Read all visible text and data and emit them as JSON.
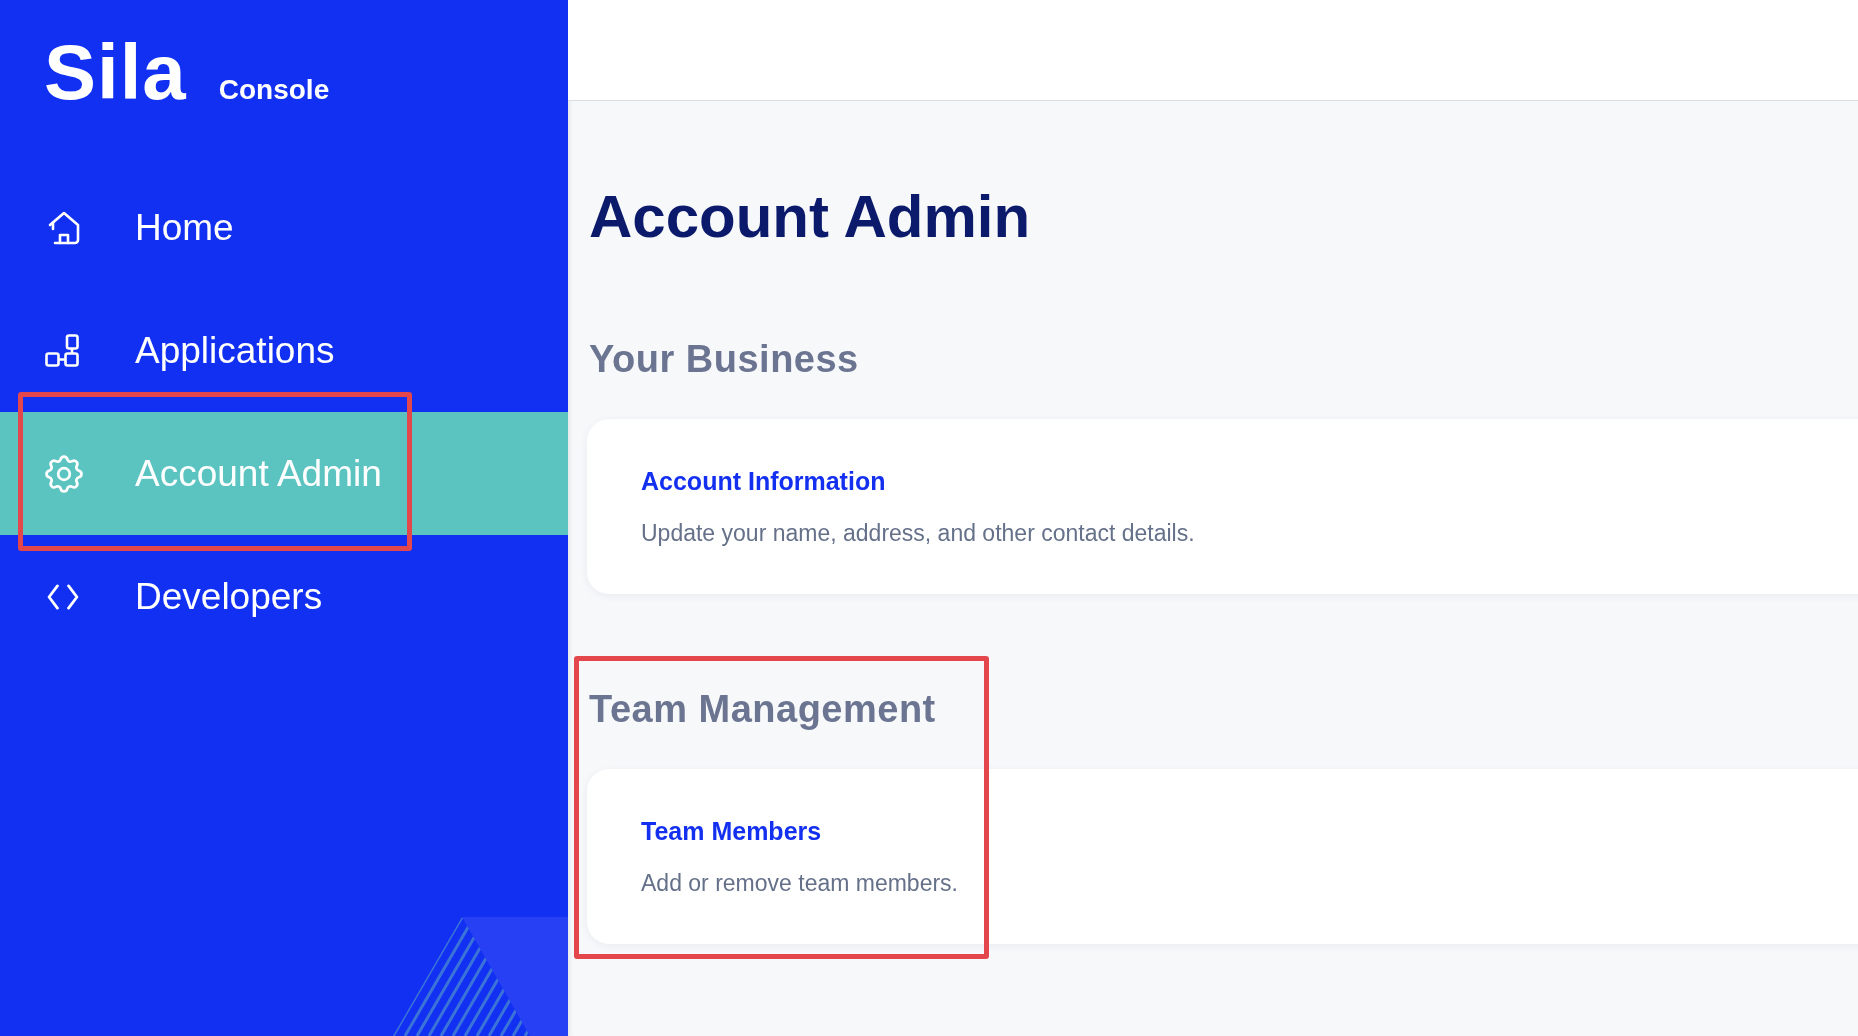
{
  "sidebar": {
    "logo": {
      "wordmark": "Sila",
      "product": "Console"
    },
    "items": [
      {
        "label": "Home",
        "selected": false,
        "highlighted": false
      },
      {
        "label": "Applications",
        "selected": false,
        "highlighted": false
      },
      {
        "label": "Account Admin",
        "selected": true,
        "highlighted": true
      },
      {
        "label": "Developers",
        "selected": false,
        "highlighted": false
      }
    ]
  },
  "page": {
    "title": "Account Admin",
    "sections": [
      {
        "heading": "Your Business",
        "highlighted": false,
        "cards": [
          {
            "title": "Account Information",
            "description": "Update your name, address, and other contact details."
          }
        ]
      },
      {
        "heading": "Team Management",
        "highlighted": true,
        "cards": [
          {
            "title": "Team Members",
            "description": "Add or remove team members."
          }
        ]
      }
    ]
  }
}
